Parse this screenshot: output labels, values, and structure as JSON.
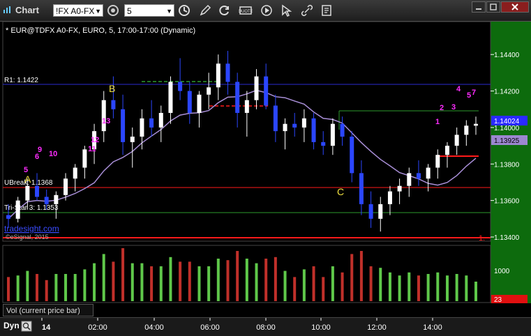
{
  "window": {
    "title": "Chart",
    "symbol_value": "!FX A0-FX",
    "interval_value": "5"
  },
  "chart": {
    "header": "* EUR@TDFX A0-FX, EURO, 5, 17:00-17:00 (Dynamic)",
    "watermark": "tradesight.com",
    "copyright": "©eSignal, 2015",
    "price_labels": [
      "1.14400",
      "1.14200",
      "1.14000",
      "1.13800",
      "1.13600",
      "1.13400"
    ],
    "last_price": "1.14024",
    "ma_price": "1.13925",
    "level_r1": "R1: 1.1422",
    "level_ubreak": "UBreak: 1.1368",
    "level_tristar": "Tri-Star 3: 1.1353",
    "level_red_tag": "1.",
    "pattern_labels": [
      "A",
      "B",
      "C"
    ],
    "count_labels": [
      "5",
      "6",
      "9",
      "10",
      "11",
      "12",
      "13",
      "1",
      "2",
      "3",
      "4",
      "5",
      "7"
    ]
  },
  "volume": {
    "label": "Vol (current price bar)",
    "axis_label": "1000",
    "current": "23"
  },
  "time_axis": {
    "labels": [
      "14",
      "02:00",
      "04:00",
      "06:00",
      "08:00",
      "10:00",
      "12:00",
      "14:00"
    ],
    "left_label": "Dyn"
  },
  "chart_data": {
    "type": "bar",
    "series": [
      {
        "name": "EUR@TDFX",
        "ohlc": [
          [
            1.1352,
            1.1358,
            1.1345,
            1.135
          ],
          [
            1.135,
            1.1362,
            1.1348,
            1.136
          ],
          [
            1.136,
            1.1372,
            1.1355,
            1.1368
          ],
          [
            1.1368,
            1.1375,
            1.136,
            1.1362
          ],
          [
            1.1362,
            1.1366,
            1.1355,
            1.1358
          ],
          [
            1.1358,
            1.1365,
            1.135,
            1.1363
          ],
          [
            1.1363,
            1.1375,
            1.136,
            1.1372
          ],
          [
            1.1372,
            1.138,
            1.1365,
            1.1378
          ],
          [
            1.1378,
            1.139,
            1.1372,
            1.1388
          ],
          [
            1.1388,
            1.1402,
            1.138,
            1.1398
          ],
          [
            1.1398,
            1.142,
            1.1392,
            1.1415
          ],
          [
            1.1415,
            1.1428,
            1.1405,
            1.141
          ],
          [
            1.141,
            1.1418,
            1.1385,
            1.1392
          ],
          [
            1.1392,
            1.14,
            1.1378,
            1.1395
          ],
          [
            1.1395,
            1.141,
            1.1388,
            1.1405
          ],
          [
            1.1405,
            1.1415,
            1.1395,
            1.14
          ],
          [
            1.14,
            1.1412,
            1.1392,
            1.1408
          ],
          [
            1.1408,
            1.1428,
            1.1402,
            1.1425
          ],
          [
            1.1425,
            1.1438,
            1.1415,
            1.142
          ],
          [
            1.142,
            1.1425,
            1.1402,
            1.1408
          ],
          [
            1.1408,
            1.142,
            1.14,
            1.1418
          ],
          [
            1.1418,
            1.143,
            1.141,
            1.1422
          ],
          [
            1.1422,
            1.144,
            1.1415,
            1.1435
          ],
          [
            1.1435,
            1.1442,
            1.1418,
            1.1425
          ],
          [
            1.1425,
            1.143,
            1.14,
            1.1408
          ],
          [
            1.1408,
            1.142,
            1.1395,
            1.1415
          ],
          [
            1.1415,
            1.1432,
            1.141,
            1.1428
          ],
          [
            1.1428,
            1.1435,
            1.141,
            1.1412
          ],
          [
            1.1412,
            1.1418,
            1.1392,
            1.1398
          ],
          [
            1.1398,
            1.1405,
            1.1388,
            1.1402
          ],
          [
            1.1402,
            1.1408,
            1.1395,
            1.14
          ],
          [
            1.14,
            1.141,
            1.1392,
            1.1405
          ],
          [
            1.1405,
            1.1408,
            1.1388,
            1.1392
          ],
          [
            1.1392,
            1.1398,
            1.1385,
            1.139
          ],
          [
            1.139,
            1.1405,
            1.1385,
            1.1402
          ],
          [
            1.1402,
            1.1406,
            1.139,
            1.1395
          ],
          [
            1.1395,
            1.1398,
            1.137,
            1.1375
          ],
          [
            1.1375,
            1.1382,
            1.1352,
            1.1358
          ],
          [
            1.1358,
            1.1365,
            1.1345,
            1.135
          ],
          [
            1.135,
            1.1362,
            1.1343,
            1.1358
          ],
          [
            1.1358,
            1.1368,
            1.1352,
            1.1365
          ],
          [
            1.1365,
            1.1372,
            1.1358,
            1.1368
          ],
          [
            1.1368,
            1.1378,
            1.1362,
            1.1375
          ],
          [
            1.1375,
            1.1382,
            1.1368,
            1.1372
          ],
          [
            1.1372,
            1.138,
            1.1365,
            1.1378
          ],
          [
            1.1378,
            1.1388,
            1.1372,
            1.1385
          ],
          [
            1.1385,
            1.1392,
            1.1378,
            1.139
          ],
          [
            1.139,
            1.14,
            1.1385,
            1.1396
          ],
          [
            1.1396,
            1.1404,
            1.139,
            1.1401
          ],
          [
            1.1401,
            1.1406,
            1.1396,
            1.1402
          ]
        ]
      },
      {
        "name": "MA",
        "values": []
      }
    ],
    "ylim": [
      1.134,
      1.145
    ]
  },
  "colors": {
    "bg": "#000000",
    "up": "#ffffff",
    "down": "#2b46ff",
    "ma": "#a98fd8",
    "red_line": "#ff1a1a",
    "green_line": "#2d9a2d",
    "blue_line": "#2a2acf",
    "magenta": "#ff2cff",
    "green_count": "#4ec24e",
    "yellow": "#f0e040",
    "axis_green": "#0d6b0d"
  }
}
